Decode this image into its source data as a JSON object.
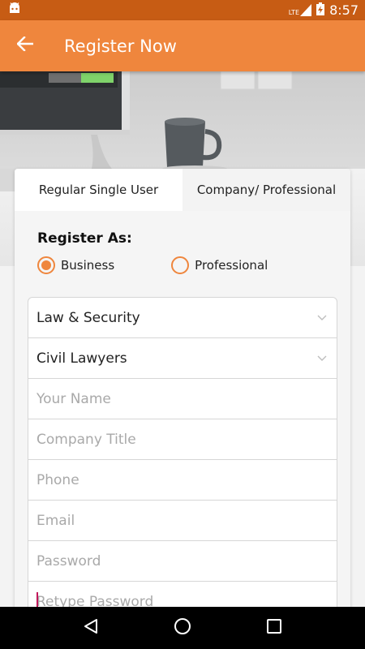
{
  "status_bar": {
    "time": "8:57",
    "network": "LTE"
  },
  "app_bar": {
    "title": "Register Now"
  },
  "tabs": [
    {
      "label": "Regular Single User",
      "active": true
    },
    {
      "label": "Company/ Professional",
      "active": false
    }
  ],
  "register_as": {
    "label": "Register As:",
    "options": [
      {
        "label": "Business",
        "selected": true
      },
      {
        "label": "Professional",
        "selected": false
      }
    ]
  },
  "form": {
    "category": "Law & Security",
    "subcategory": "Civil Lawyers",
    "name_placeholder": "Your Name",
    "company_placeholder": "Company Title",
    "phone_placeholder": "Phone",
    "email_placeholder": "Email",
    "password_placeholder": "Password",
    "retype_placeholder": "Retype Password"
  },
  "colors": {
    "accent": "#ef863d",
    "status_bar": "#c75c14"
  }
}
